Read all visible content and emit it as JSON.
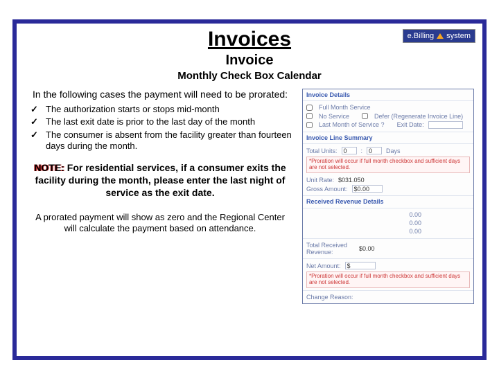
{
  "logo": {
    "brand": "e.Billing",
    "word": "system"
  },
  "title": "Invoices",
  "subtitle": "Invoice",
  "subsub": "Monthly Check Box Calendar",
  "lead": "In the following cases the payment will need to be prorated:",
  "bullets": [
    "The authorization starts or stops mid-month",
    "The last exit date is prior to the last day of the month",
    "The consumer is absent from the facility greater than fourteen days during the month."
  ],
  "note": {
    "label": "NOTE:",
    "body": "For residential services, if a consumer exits the facility during the month, please enter the last night of service as the exit date."
  },
  "foot": "A prorated payment will show as zero and the Regional Center will calculate the payment based on attendance.",
  "panel": {
    "header": "Invoice Details",
    "full_month_label": "Full Month Service",
    "no_service_label": "No Service",
    "defer_label": "Defer (Regenerate Invoice Line)",
    "last_month_label": "Last Month of Service ?",
    "exit_date_label": "Exit Date:",
    "line_header": "Invoice Line Summary",
    "total_units_label": "Total Units:",
    "total_units_a": "0",
    "total_units_b": "0",
    "days_label": "Days",
    "warn1": "*Proration will occur if full month checkbox and sufficient days are not selected.",
    "unit_rate_label": "Unit Rate:",
    "unit_rate_value": "$031.050",
    "gross_label": "Gross Amount:",
    "gross_value": "$0.00",
    "recv_header": "Received Revenue Details",
    "recv_a": "0.00",
    "recv_b": "0.00",
    "recv_c": "0.00",
    "total_recv_label": "Total Received Revenue:",
    "total_recv_value": "$0.00",
    "net_label": "Net Amount:",
    "net_value": "$",
    "warn2": "*Proration will occur if full month checkbox and sufficient days are not selected.",
    "change_label": "Change Reason:"
  }
}
